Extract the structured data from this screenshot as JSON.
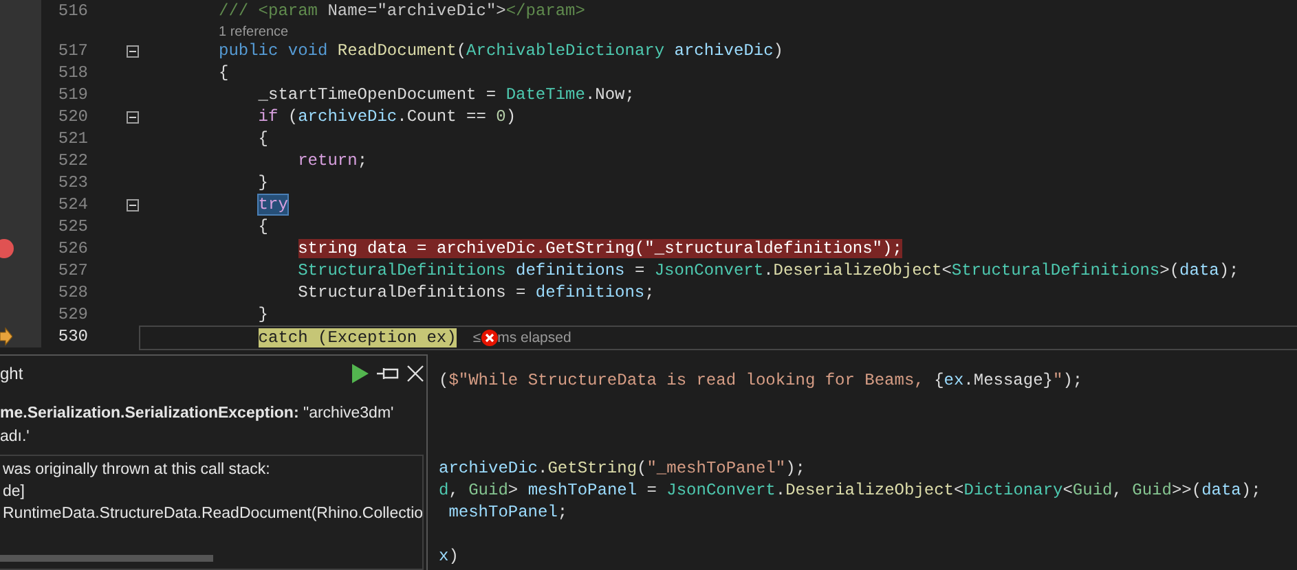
{
  "editor": {
    "lines": [
      {
        "kind": "code",
        "number": "516",
        "tokens": [
          {
            "kind": "doc",
            "t": "/// <param "
          },
          {
            "kind": "docattr",
            "t": "Name=\"archiveDic\">"
          },
          {
            "kind": "doc",
            "t": "</param>"
          }
        ]
      },
      {
        "kind": "codelens",
        "text": "1 reference"
      },
      {
        "kind": "code",
        "number": "517",
        "fold": true,
        "tokens": [
          {
            "kind": "kw",
            "t": "public void "
          },
          {
            "kind": "method",
            "t": "ReadDocument"
          },
          {
            "kind": "plain",
            "t": "("
          },
          {
            "kind": "type",
            "t": "ArchivableDictionary "
          },
          {
            "kind": "var",
            "t": "archiveDic"
          },
          {
            "kind": "plain",
            "t": ")"
          }
        ]
      },
      {
        "kind": "code",
        "number": "518",
        "tokens": [
          {
            "kind": "plain",
            "t": "{"
          }
        ],
        "children": [
          {
            "kind": "code",
            "number": "519",
            "tokens": [
              {
                "kind": "plain",
                "t": "_startTimeOpenDocument = "
              },
              {
                "kind": "type",
                "t": "DateTime"
              },
              {
                "kind": "plain",
                "t": ".Now;"
              }
            ]
          },
          {
            "kind": "code",
            "number": "520",
            "fold": true,
            "tokens": [
              {
                "kind": "ctrl",
                "t": "if"
              },
              {
                "kind": "plain",
                "t": " ("
              },
              {
                "kind": "var",
                "t": "archiveDic"
              },
              {
                "kind": "plain",
                "t": ".Count == "
              },
              {
                "kind": "num",
                "t": "0"
              },
              {
                "kind": "plain",
                "t": ")"
              }
            ]
          },
          {
            "kind": "code",
            "number": "521",
            "tokens": [
              {
                "kind": "plain",
                "t": "{"
              }
            ],
            "children": [
              {
                "kind": "code",
                "number": "522",
                "tokens": [
                  {
                    "kind": "ctrl",
                    "t": "return"
                  },
                  {
                    "kind": "plain",
                    "t": ";"
                  }
                ]
              }
            ]
          },
          {
            "kind": "code",
            "number": "523",
            "tokens": [
              {
                "kind": "plain",
                "t": "}"
              }
            ]
          },
          {
            "kind": "code",
            "number": "524",
            "fold": true,
            "selected": true,
            "tokens": [
              {
                "kind": "ctrl",
                "t": "try"
              }
            ]
          },
          {
            "kind": "code",
            "number": "525",
            "tokens": [
              {
                "kind": "plain",
                "t": "{"
              }
            ],
            "children": [
              {
                "kind": "code",
                "number": "526",
                "breakpoint": true,
                "tokens": [
                  {
                    "kind": "kw",
                    "t": "string "
                  },
                  {
                    "kind": "var",
                    "t": "data"
                  },
                  {
                    "kind": "plain",
                    "t": " = "
                  },
                  {
                    "kind": "var",
                    "t": "archiveDic"
                  },
                  {
                    "kind": "plain",
                    "t": "."
                  },
                  {
                    "kind": "method",
                    "t": "GetString"
                  },
                  {
                    "kind": "plain",
                    "t": "("
                  },
                  {
                    "kind": "str",
                    "t": "\"_structuraldefinitions\""
                  },
                  {
                    "kind": "plain",
                    "t": ");"
                  }
                ]
              },
              {
                "kind": "code",
                "number": "527",
                "tokens": [
                  {
                    "kind": "type",
                    "t": "StructuralDefinitions "
                  },
                  {
                    "kind": "var",
                    "t": "definitions"
                  },
                  {
                    "kind": "plain",
                    "t": " = "
                  },
                  {
                    "kind": "type",
                    "t": "JsonConvert"
                  },
                  {
                    "kind": "plain",
                    "t": "."
                  },
                  {
                    "kind": "method",
                    "t": "DeserializeObject"
                  },
                  {
                    "kind": "plain",
                    "t": "<"
                  },
                  {
                    "kind": "type",
                    "t": "StructuralDefinitions"
                  },
                  {
                    "kind": "plain",
                    "t": ">("
                  },
                  {
                    "kind": "var",
                    "t": "data"
                  },
                  {
                    "kind": "plain",
                    "t": ");"
                  }
                ]
              },
              {
                "kind": "code",
                "number": "528",
                "tokens": [
                  {
                    "kind": "plain",
                    "t": "StructuralDefinitions = "
                  },
                  {
                    "kind": "var",
                    "t": "definitions"
                  },
                  {
                    "kind": "plain",
                    "t": ";"
                  }
                ]
              }
            ]
          },
          {
            "kind": "code",
            "number": "529",
            "tokens": [
              {
                "kind": "plain",
                "t": "}"
              }
            ]
          },
          {
            "kind": "code",
            "number": "530",
            "current_statement": true,
            "tokens": [
              {
                "kind": "ctrl",
                "t": "catch"
              },
              {
                "kind": "plain",
                "t": " ("
              },
              {
                "kind": "type",
                "t": "Exception "
              },
              {
                "kind": "var",
                "t": "ex"
              },
              {
                "kind": "plain",
                "t": ")"
              }
            ],
            "perf_tip": {
              "prefix": "≤",
              "suffix": "ms elapsed"
            }
          }
        ]
      }
    ],
    "lines_beside_popup": [
      {
        "kind": "blank"
      },
      {
        "kind": "code",
        "tokens": [
          {
            "kind": "plain",
            "t": "("
          },
          {
            "kind": "str",
            "t": "$\"While StructureData is read looking for Beams, "
          },
          {
            "kind": "plain",
            "t": "{"
          },
          {
            "kind": "var",
            "t": "ex"
          },
          {
            "kind": "plain",
            "t": ".Message}"
          },
          {
            "kind": "str",
            "t": "\""
          },
          {
            "kind": "plain",
            "t": ");"
          }
        ]
      },
      {
        "kind": "blank"
      },
      {
        "kind": "blank"
      },
      {
        "kind": "blank"
      },
      {
        "kind": "code",
        "tokens": [
          {
            "kind": "var",
            "t": "archiveDic"
          },
          {
            "kind": "plain",
            "t": "."
          },
          {
            "kind": "method",
            "t": "GetString"
          },
          {
            "kind": "plain",
            "t": "("
          },
          {
            "kind": "str",
            "t": "\"_meshToPanel\""
          },
          {
            "kind": "plain",
            "t": ");"
          }
        ]
      },
      {
        "kind": "code",
        "tokens": [
          {
            "kind": "type",
            "t": "d"
          },
          {
            "kind": "plain",
            "t": ", "
          },
          {
            "kind": "struct",
            "t": "Guid"
          },
          {
            "kind": "plain",
            "t": "> "
          },
          {
            "kind": "var",
            "t": "meshToPanel"
          },
          {
            "kind": "plain",
            "t": " = "
          },
          {
            "kind": "type",
            "t": "JsonConvert"
          },
          {
            "kind": "plain",
            "t": "."
          },
          {
            "kind": "method",
            "t": "DeserializeObject"
          },
          {
            "kind": "plain",
            "t": "<"
          },
          {
            "kind": "type",
            "t": "Dictionary"
          },
          {
            "kind": "plain",
            "t": "<"
          },
          {
            "kind": "struct",
            "t": "Guid"
          },
          {
            "kind": "plain",
            "t": ", "
          },
          {
            "kind": "struct",
            "t": "Guid"
          },
          {
            "kind": "plain",
            "t": ">>("
          },
          {
            "kind": "var",
            "t": "data"
          },
          {
            "kind": "plain",
            "t": ");"
          }
        ]
      },
      {
        "kind": "code",
        "tokens": [
          {
            "kind": "var",
            "t": " meshToPanel"
          },
          {
            "kind": "plain",
            "t": ";"
          }
        ]
      },
      {
        "kind": "blank"
      },
      {
        "kind": "code",
        "tokens": [
          {
            "kind": "var",
            "t": "x"
          },
          {
            "kind": "plain",
            "t": ")"
          }
        ]
      }
    ]
  },
  "exception_popup": {
    "title": "ght",
    "message_lines": [
      "**me.Serialization.SerializationException:** \"archive3dm'",
      "adı.'"
    ],
    "call_stack_lines": [
      "was originally thrown at this call stack:",
      "de]",
      "RuntimeData.StructureData.ReadDocument(Rhino.Collectio"
    ]
  }
}
